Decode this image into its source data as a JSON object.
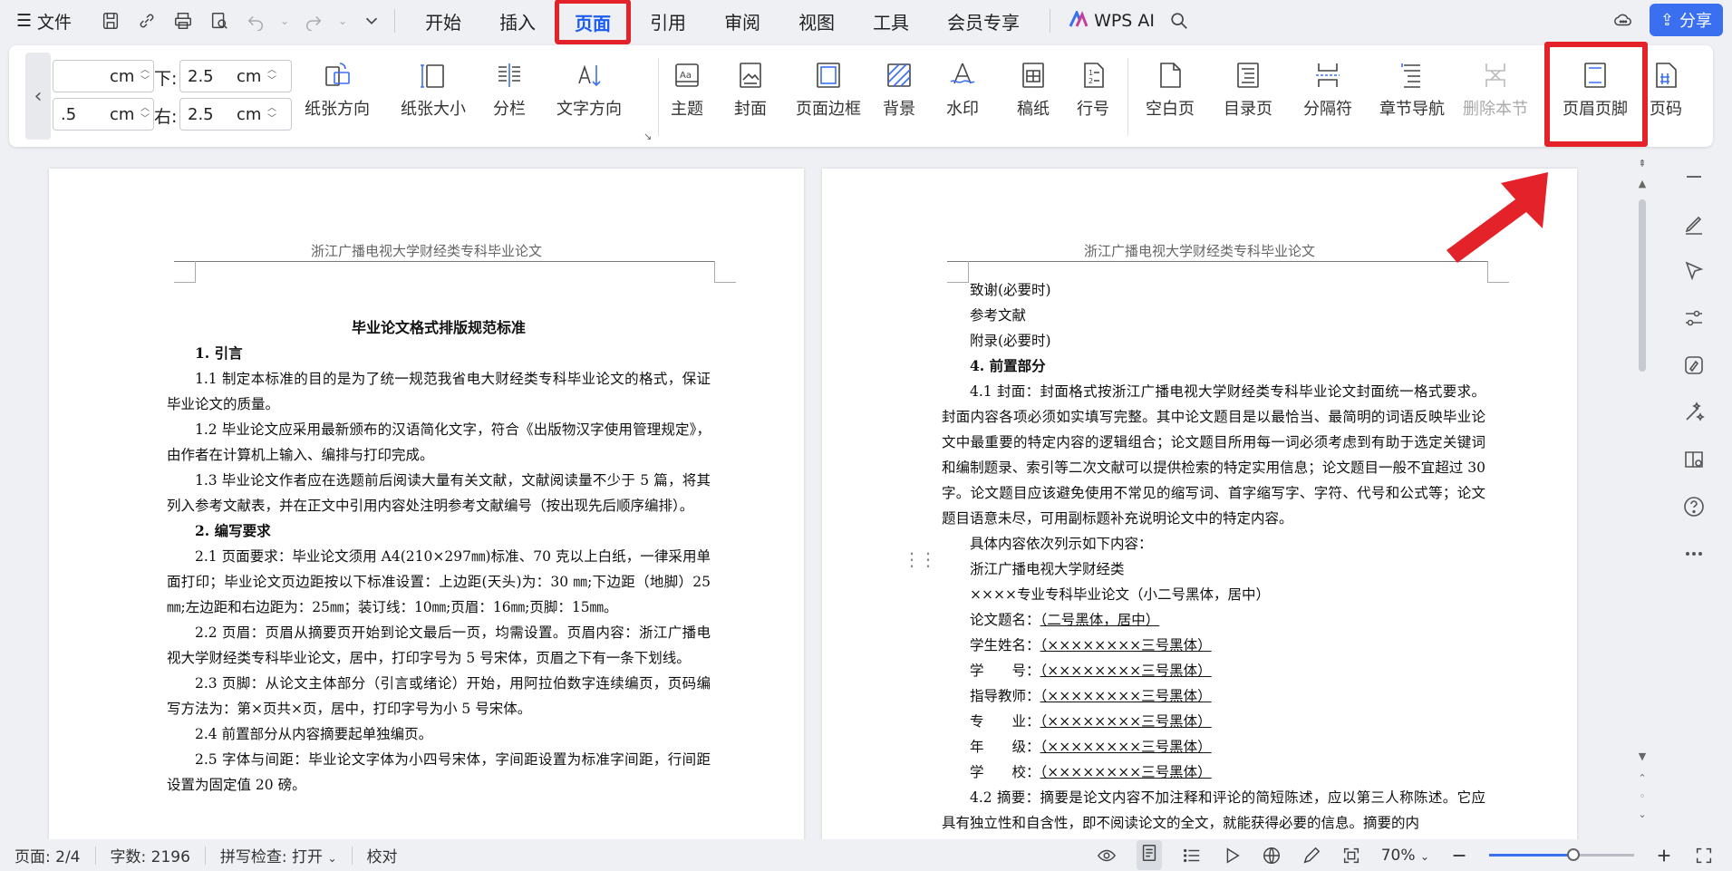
{
  "menubar": {
    "menu_label": "文件",
    "tabs": [
      "开始",
      "插入",
      "页面",
      "引用",
      "审阅",
      "视图",
      "工具",
      "会员专享"
    ],
    "active_tab": "页面",
    "wps_ai": "WPS AI",
    "share_label": "分享"
  },
  "ribbon": {
    "margins": {
      "top_value": "",
      "top_unit": "cm",
      "left_value": ".5",
      "left_unit": "cm",
      "bottom_label": "下:",
      "bottom_value": "2.5",
      "bottom_unit": "cm",
      "right_label": "右:",
      "right_value": "2.5",
      "right_unit": "cm"
    },
    "buttons": {
      "orientation": "纸张方向",
      "size": "纸张大小",
      "columns": "分栏",
      "text_direction": "文字方向",
      "theme": "主题",
      "cover": "封面",
      "page_border": "页面边框",
      "background": "背景",
      "watermark": "水印",
      "manuscript": "稿纸",
      "line_number": "行号",
      "blank_page": "空白页",
      "toc_page": "目录页",
      "separator": "分隔符",
      "chapter_nav": "章节导航",
      "delete_section": "删除本节",
      "header_footer": "页眉页脚",
      "page_number": "页码"
    }
  },
  "document": {
    "header_text": "浙江广播电视大学财经类专科毕业论文",
    "page1": {
      "title": "毕业论文格式排版规范标准",
      "h1": "1. 引言",
      "p1_1": "1.1 制定本标准的目的是为了统一规范我省电大财经类专科毕业论文的格式，保证毕业论文的质量。",
      "p1_2": "1.2 毕业论文应采用最新颁布的汉语简化文字，符合《出版物汉字使用管理规定》，由作者在计算机上输入、编排与打印完成。",
      "p1_3": "1.3 毕业论文作者应在选题前后阅读大量有关文献，文献阅读量不少于 5 篇，将其列入参考文献表，并在正文中引用内容处注明参考文献编号（按出现先后顺序编排）。",
      "h2": "2. 编写要求",
      "p2_1": "2.1 页面要求：毕业论文须用 A4(210×297㎜)标准、70 克以上白纸，一律采用单面打印；毕业论文页边距按以下标准设置：上边距(天头)为：30 ㎜;下边距（地脚）25㎜;左边距和右边距为：25㎜；装订线：10㎜;页眉：16㎜;页脚：15㎜。",
      "p2_2": "2.2 页眉：页眉从摘要页开始到论文最后一页，均需设置。页眉内容：浙江广播电视大学财经类专科毕业论文，居中，打印字号为 5 号宋体，页眉之下有一条下划线。",
      "p2_3": "2.3 页脚：从论文主体部分（引言或绪论）开始，用阿拉伯数字连续编页，页码编写方法为：第×页共×页，居中，打印字号为小 5 号宋体。",
      "p2_4": "2.4 前置部分从内容摘要起单独编页。",
      "p2_5": "2.5 字体与间距：毕业论文字体为小四号宋体，字间距设置为标准字间距，行间距设置为固定值 20 磅。"
    },
    "page2": {
      "l1": "致谢(必要时)",
      "l2": "参考文献",
      "l3": "附录(必要时)",
      "h4": "4. 前置部分",
      "p4_1": "4.1 封面：封面格式按浙江广播电视大学财经类专科毕业论文封面统一格式要求。封面内容各项必须如实填写完整。其中论文题目是以最恰当、最简明的词语反映毕业论文中最重要的特定内容的逻辑组合；论文题目所用每一词必须考虑到有助于选定关键词和编制题录、索引等二次文献可以提供检索的特定实用信息；论文题目一般不宜超过 30 字。论文题目应该避免使用不常见的缩写词、首字缩写字、字符、代号和公式等；论文题目语意未尽，可用副标题补充说明论文中的特定内容。",
      "l5": "具体内容依次列示如下内容：",
      "l6": "浙江广播电视大学财经类",
      "l7": "××××专业专科毕业论文（小二号黑体，居中）",
      "f1_label": "论文题名：",
      "f1_value": "（二号黑体，居中）",
      "f2_label": "学生姓名：",
      "f2_value": "（××××××××三号黑体）",
      "f3_label": "学　　号：",
      "f3_value": "（××××××××三号黑体）",
      "f4_label": "指导教师：",
      "f4_value": "（××××××××三号黑体）",
      "f5_label": "专　　业：",
      "f5_value": "（××××××××三号黑体）",
      "f6_label": "年　　级：",
      "f6_value": "（××××××××三号黑体）",
      "f7_label": "学　　校：",
      "f7_value": "（××××××××三号黑体）",
      "p4_2": "4.2 摘要：摘要是论文内容不加注释和评论的简短陈述，应以第三人称陈述。它应具有独立性和自含性，即不阅读论文的全文，就能获得必要的信息。摘要的内"
    }
  },
  "statusbar": {
    "page": "页面: 2/4",
    "words": "字数: 2196",
    "spellcheck": "拼写检查: 打开",
    "proofread": "校对",
    "zoom": "70%",
    "zoom_fraction": 0.58
  },
  "colors": {
    "accent": "#1c5cf0",
    "highlight": "#e3222a",
    "share": "#3a6ff0"
  }
}
